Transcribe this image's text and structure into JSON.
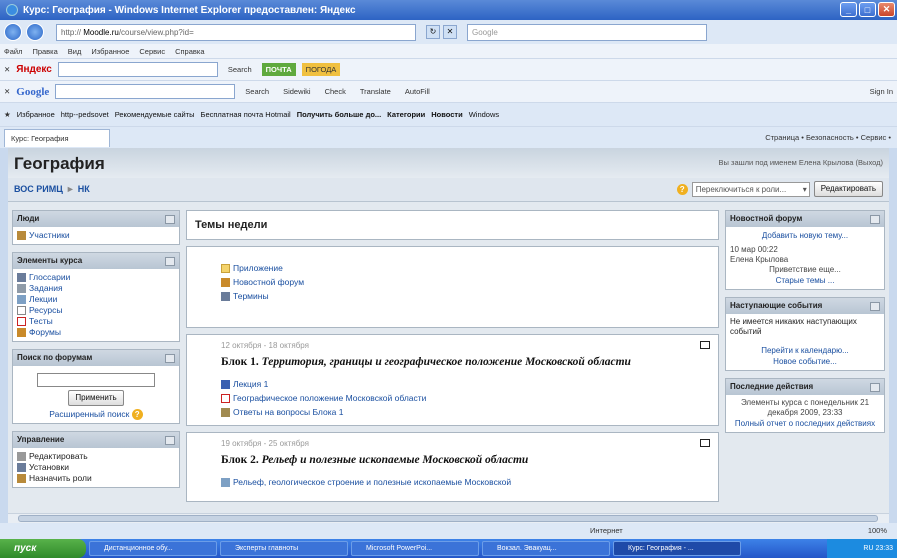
{
  "window": {
    "title": "Курс: География - Windows Internet Explorer предоставлен: Яндекс"
  },
  "address": {
    "url_host": "Moodle.ru",
    "url_path": "/course/view.php?id="
  },
  "search": {
    "placeholder": "Google"
  },
  "menu": [
    "Файл",
    "Правка",
    "Вид",
    "Избранное",
    "Сервис",
    "Справка"
  ],
  "toolbar1": {
    "brand": "Яндекс",
    "search_label": "Search",
    "chip1": "ПОЧТА",
    "chip2": "ПОГОДА"
  },
  "toolbar2": {
    "brand": "Google",
    "items": [
      "Search",
      "Sidewiki",
      "Check",
      "Translate",
      "AutoFill",
      "Sign In"
    ]
  },
  "favorites": {
    "label": "Избранное",
    "items": [
      "http--pedsovet",
      "Рекомендуемые сайты",
      "Бесплатная почта Hotmail",
      "Получить больше до...",
      "Категории",
      "Новости",
      "Windows"
    ]
  },
  "tab": {
    "label": "Курс: География",
    "right": "Страница • Безопасность • Сервис •"
  },
  "page": {
    "title": "География",
    "login_text": "Вы зашли под именем Елена Крылова (Выход)",
    "breadcrumb": [
      "ВОС РИМЦ",
      "НК"
    ],
    "role_select": "Переключиться к роли...",
    "edit_button": "Редактировать"
  },
  "left": {
    "people": {
      "title": "Люди",
      "items": [
        "Участники"
      ]
    },
    "activities": {
      "title": "Элементы курса",
      "items": [
        "Глоссарии",
        "Задания",
        "Лекции",
        "Ресурсы",
        "Тесты",
        "Форумы"
      ]
    },
    "forum_search": {
      "title": "Поиск по форумам",
      "button": "Применить",
      "advanced": "Расширенный поиск"
    },
    "admin": {
      "title": "Управление",
      "items": [
        "Редактировать",
        "Установки",
        "Назначить роли"
      ]
    }
  },
  "main": {
    "heading": "Темы недели",
    "section0": [
      "Приложение",
      "Новостной форум",
      "Термины"
    ],
    "sections": [
      {
        "dates": "12 октября - 18 октября",
        "title_plain": "Блок 1.",
        "title_italic": "Территория, границы и географическое положение Московской области",
        "items": [
          "Лекция 1",
          "Географическое положение Московской области",
          "Ответы на вопросы Блока 1"
        ]
      },
      {
        "dates": "19 октября - 25 октября",
        "title_plain": "Блок 2.",
        "title_italic": "Рельеф и полезные ископаемые Московской области",
        "items": [
          "Рельеф, геологическое строение и полезные ископаемые Московской"
        ]
      }
    ]
  },
  "right": {
    "news": {
      "title": "Новостной форум",
      "add": "Добавить новую тему...",
      "date": "10 мар 00:22",
      "author": "Елена Крылова",
      "post": "Приветствие еще...",
      "old": "Старые темы ..."
    },
    "events": {
      "title": "Наступающие события",
      "text": "Не имеется никаких наступающих событий",
      "calendar": "Перейти к календарю...",
      "new": "Новое событие..."
    },
    "activity": {
      "title": "Последние действия",
      "text": "Элементы курса с понедельник 21 декабря 2009, 23:33",
      "report": "Полный отчет о последних действиях"
    }
  },
  "status": {
    "zone": "Интернет",
    "zoom": "100%"
  },
  "taskbar": {
    "start": "пуск",
    "tasks": [
      "Дистанционное обу...",
      "Эксперты главноты",
      "Microsoft PowerPoi...",
      "Вокзал. Эвакуац...",
      "Курс: География - ..."
    ],
    "tray": "RU 23:33"
  }
}
